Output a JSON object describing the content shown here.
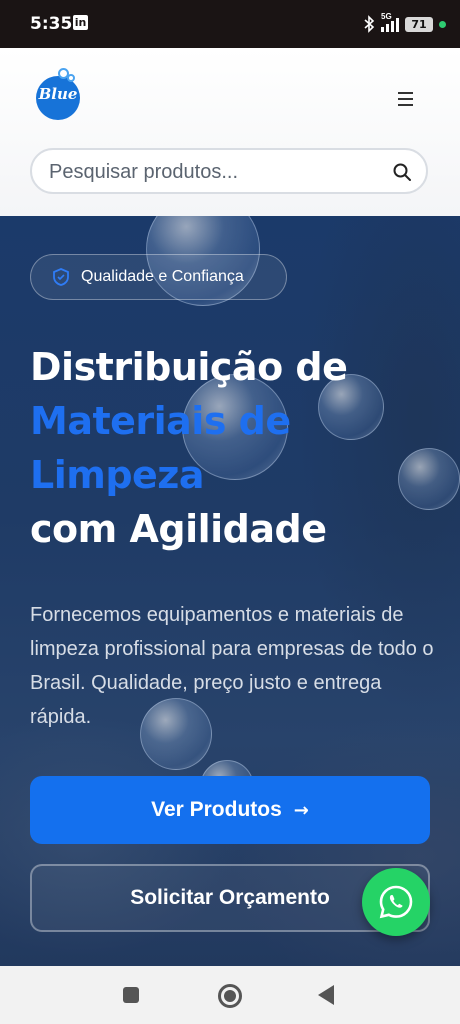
{
  "status_bar": {
    "time": "5:35",
    "network": "5G",
    "battery": "71"
  },
  "header": {
    "logo_text": "Blue",
    "search": {
      "placeholder": "Pesquisar produtos..."
    }
  },
  "hero": {
    "badge": "Qualidade e Confiança",
    "title_line1": "Distribuição de",
    "title_highlight1": "Materiais de",
    "title_highlight2": "Limpeza",
    "title_line2": "com Agilidade",
    "description": "Fornecemos equipamentos e materiais de limpeza profissional para empresas de todo o Brasil. Qualidade, preço justo e entrega rápida.",
    "primary_button": "Ver Produtos",
    "primary_button_arrow": "→",
    "secondary_button": "Solicitar Orçamento"
  },
  "colors": {
    "accent": "#1470ee",
    "highlight_text": "#1e6ff0",
    "whatsapp": "#25d366",
    "hero_bg": "#1f3b66"
  },
  "icons": [
    "linkedin-icon",
    "bluetooth-icon",
    "signal-icon",
    "battery-icon",
    "menu-icon",
    "search-icon",
    "shield-icon",
    "arrow-right-icon",
    "whatsapp-icon"
  ]
}
